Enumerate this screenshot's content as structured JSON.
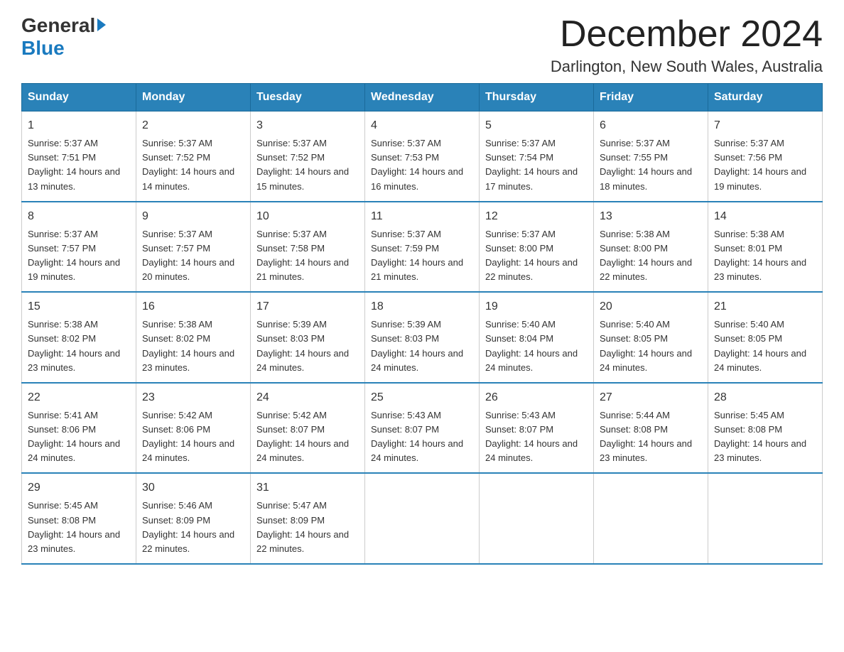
{
  "logo": {
    "line1": "General",
    "line2": "Blue"
  },
  "title": "December 2024",
  "subtitle": "Darlington, New South Wales, Australia",
  "days_header": [
    "Sunday",
    "Monday",
    "Tuesday",
    "Wednesday",
    "Thursday",
    "Friday",
    "Saturday"
  ],
  "weeks": [
    [
      {
        "num": "1",
        "sunrise": "5:37 AM",
        "sunset": "7:51 PM",
        "daylight": "14 hours and 13 minutes."
      },
      {
        "num": "2",
        "sunrise": "5:37 AM",
        "sunset": "7:52 PM",
        "daylight": "14 hours and 14 minutes."
      },
      {
        "num": "3",
        "sunrise": "5:37 AM",
        "sunset": "7:52 PM",
        "daylight": "14 hours and 15 minutes."
      },
      {
        "num": "4",
        "sunrise": "5:37 AM",
        "sunset": "7:53 PM",
        "daylight": "14 hours and 16 minutes."
      },
      {
        "num": "5",
        "sunrise": "5:37 AM",
        "sunset": "7:54 PM",
        "daylight": "14 hours and 17 minutes."
      },
      {
        "num": "6",
        "sunrise": "5:37 AM",
        "sunset": "7:55 PM",
        "daylight": "14 hours and 18 minutes."
      },
      {
        "num": "7",
        "sunrise": "5:37 AM",
        "sunset": "7:56 PM",
        "daylight": "14 hours and 19 minutes."
      }
    ],
    [
      {
        "num": "8",
        "sunrise": "5:37 AM",
        "sunset": "7:57 PM",
        "daylight": "14 hours and 19 minutes."
      },
      {
        "num": "9",
        "sunrise": "5:37 AM",
        "sunset": "7:57 PM",
        "daylight": "14 hours and 20 minutes."
      },
      {
        "num": "10",
        "sunrise": "5:37 AM",
        "sunset": "7:58 PM",
        "daylight": "14 hours and 21 minutes."
      },
      {
        "num": "11",
        "sunrise": "5:37 AM",
        "sunset": "7:59 PM",
        "daylight": "14 hours and 21 minutes."
      },
      {
        "num": "12",
        "sunrise": "5:37 AM",
        "sunset": "8:00 PM",
        "daylight": "14 hours and 22 minutes."
      },
      {
        "num": "13",
        "sunrise": "5:38 AM",
        "sunset": "8:00 PM",
        "daylight": "14 hours and 22 minutes."
      },
      {
        "num": "14",
        "sunrise": "5:38 AM",
        "sunset": "8:01 PM",
        "daylight": "14 hours and 23 minutes."
      }
    ],
    [
      {
        "num": "15",
        "sunrise": "5:38 AM",
        "sunset": "8:02 PM",
        "daylight": "14 hours and 23 minutes."
      },
      {
        "num": "16",
        "sunrise": "5:38 AM",
        "sunset": "8:02 PM",
        "daylight": "14 hours and 23 minutes."
      },
      {
        "num": "17",
        "sunrise": "5:39 AM",
        "sunset": "8:03 PM",
        "daylight": "14 hours and 24 minutes."
      },
      {
        "num": "18",
        "sunrise": "5:39 AM",
        "sunset": "8:03 PM",
        "daylight": "14 hours and 24 minutes."
      },
      {
        "num": "19",
        "sunrise": "5:40 AM",
        "sunset": "8:04 PM",
        "daylight": "14 hours and 24 minutes."
      },
      {
        "num": "20",
        "sunrise": "5:40 AM",
        "sunset": "8:05 PM",
        "daylight": "14 hours and 24 minutes."
      },
      {
        "num": "21",
        "sunrise": "5:40 AM",
        "sunset": "8:05 PM",
        "daylight": "14 hours and 24 minutes."
      }
    ],
    [
      {
        "num": "22",
        "sunrise": "5:41 AM",
        "sunset": "8:06 PM",
        "daylight": "14 hours and 24 minutes."
      },
      {
        "num": "23",
        "sunrise": "5:42 AM",
        "sunset": "8:06 PM",
        "daylight": "14 hours and 24 minutes."
      },
      {
        "num": "24",
        "sunrise": "5:42 AM",
        "sunset": "8:07 PM",
        "daylight": "14 hours and 24 minutes."
      },
      {
        "num": "25",
        "sunrise": "5:43 AM",
        "sunset": "8:07 PM",
        "daylight": "14 hours and 24 minutes."
      },
      {
        "num": "26",
        "sunrise": "5:43 AM",
        "sunset": "8:07 PM",
        "daylight": "14 hours and 24 minutes."
      },
      {
        "num": "27",
        "sunrise": "5:44 AM",
        "sunset": "8:08 PM",
        "daylight": "14 hours and 23 minutes."
      },
      {
        "num": "28",
        "sunrise": "5:45 AM",
        "sunset": "8:08 PM",
        "daylight": "14 hours and 23 minutes."
      }
    ],
    [
      {
        "num": "29",
        "sunrise": "5:45 AM",
        "sunset": "8:08 PM",
        "daylight": "14 hours and 23 minutes."
      },
      {
        "num": "30",
        "sunrise": "5:46 AM",
        "sunset": "8:09 PM",
        "daylight": "14 hours and 22 minutes."
      },
      {
        "num": "31",
        "sunrise": "5:47 AM",
        "sunset": "8:09 PM",
        "daylight": "14 hours and 22 minutes."
      },
      null,
      null,
      null,
      null
    ]
  ]
}
